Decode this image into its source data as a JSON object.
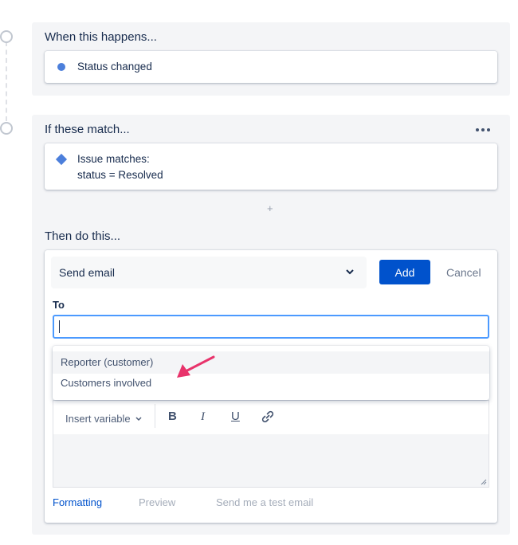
{
  "trigger": {
    "title": "When this happens...",
    "item": "Status changed"
  },
  "condition": {
    "title": "If these match...",
    "line1": "Issue matches:",
    "line2": "status = Resolved"
  },
  "add_component_symbol": "+",
  "action": {
    "title": "Then do this...",
    "selected_action": "Send email",
    "add_label": "Add",
    "cancel_label": "Cancel",
    "to_label": "To",
    "to_value": "",
    "suggestions": [
      "Reporter (customer)",
      "Customers involved"
    ],
    "toolbar": {
      "insert_variable": "Insert variable",
      "bold": "B",
      "italic": "I",
      "underline": "U"
    },
    "links": {
      "formatting": "Formatting",
      "preview": "Preview",
      "test_email": "Send me a test email"
    }
  },
  "colors": {
    "accent": "#0052cc",
    "node_icon": "#4c7fdb",
    "annotation_arrow": "#e8336b",
    "input_focus": "#4c9aff"
  }
}
